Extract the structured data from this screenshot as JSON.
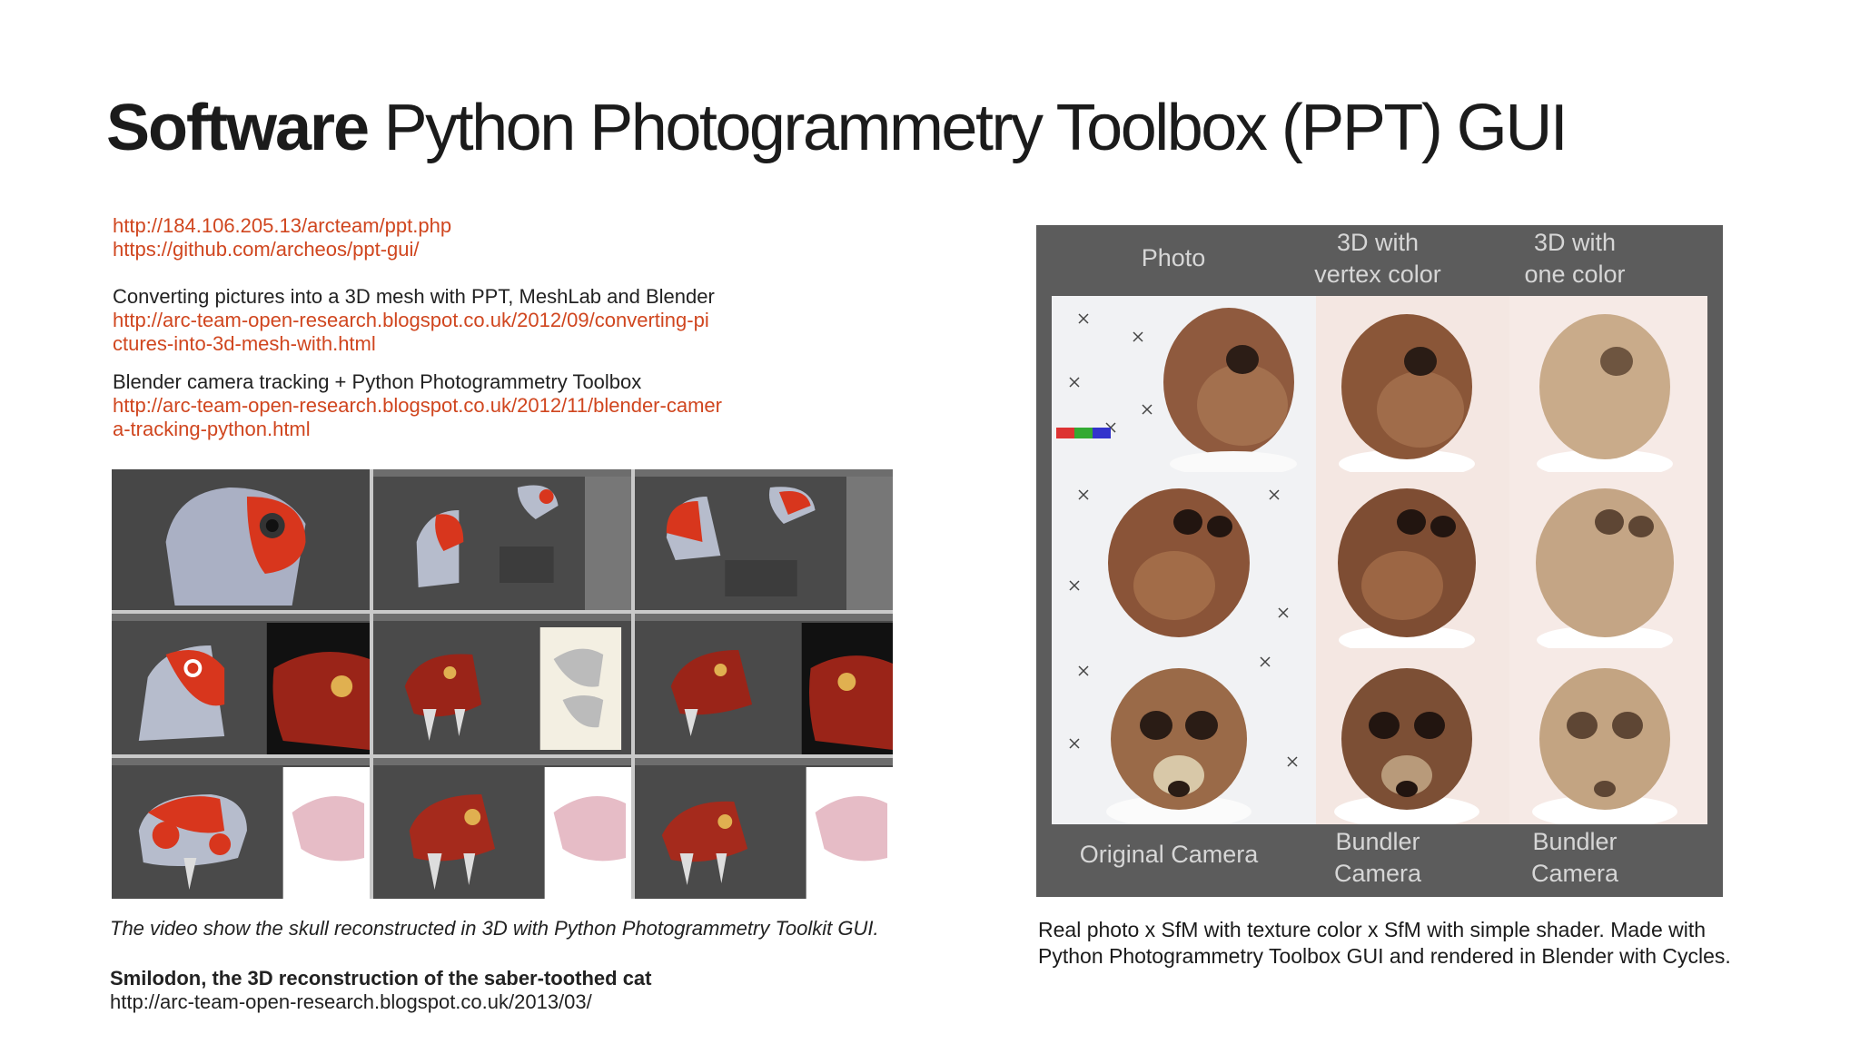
{
  "header": {
    "title_bold": "Software",
    "title_rest": "Python Photogrammetry Toolbox (PPT) GUI"
  },
  "links": {
    "ppt_url": "http://184.106.205.13/arcteam/ppt.php",
    "github_url": "https://github.com/archeos/ppt-gui/",
    "converting_desc": "Converting pictures into a 3D mesh with PPT, MeshLab and Blender",
    "converting_url_1": "http://arc-team-open-research.blogspot.co.uk/2012/09/converting-pi",
    "converting_url_2": "ctures-into-3d-mesh-with.html",
    "tracking_desc": "Blender camera tracking + Python Photogrammetry Toolbox",
    "tracking_url_1": "http://arc-team-open-research.blogspot.co.uk/2012/11/blender-camer",
    "tracking_url_2": "a-tracking-python.html"
  },
  "left_caption": {
    "video_text": "The video show the skull reconstructed in 3D with Python Photogrammetry Toolkit GUI.",
    "smilodon_title": "Smilodon, the 3D reconstruction of the saber-toothed cat",
    "smilodon_url": "http://arc-team-open-research.blogspot.co.uk/2013/03/"
  },
  "skull_panel": {
    "top_headers": [
      "Photo",
      "3D with\nvertex color",
      "3D with\none color"
    ],
    "bottom_headers": [
      "Original Camera",
      "Bundler\nCamera",
      "Bundler\nCamera"
    ]
  },
  "right_caption": {
    "text": "Real photo x SfM with texture color x SfM with simple shader. Made with Python Photogrammetry Toolbox GUI and rendered in Blender with Cycles."
  },
  "colors": {
    "link": "#d0461f",
    "panel_bg": "#5c5c5c",
    "model_red": "#d8321c",
    "bone": "#8a5a3a"
  }
}
